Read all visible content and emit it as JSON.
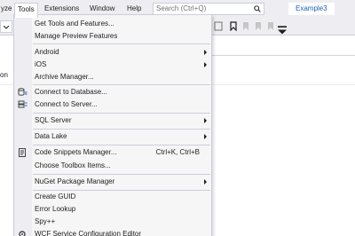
{
  "menubar": {
    "partial_left": "yze",
    "tools": "Tools",
    "extensions": "Extensions",
    "window": "Window",
    "help": "Help",
    "search_placeholder": "Search (Ctrl+Q)",
    "project": "Example3"
  },
  "editor": {
    "partial_text": "on"
  },
  "tools_menu": {
    "items": [
      {
        "label": "Get Tools and Features...",
        "icon": "",
        "shortcut": "",
        "submenu": false
      },
      {
        "label": "Manage Preview Features",
        "icon": "",
        "shortcut": "",
        "submenu": false
      },
      {
        "label": "Android",
        "icon": "",
        "shortcut": "",
        "submenu": true
      },
      {
        "label": "iOS",
        "icon": "",
        "shortcut": "",
        "submenu": true
      },
      {
        "label": "Archive Manager...",
        "icon": "",
        "shortcut": "",
        "submenu": false
      },
      {
        "label": "Connect to Database...",
        "icon": "database-connect-icon",
        "shortcut": "",
        "submenu": false
      },
      {
        "label": "Connect to Server...",
        "icon": "server-connect-icon",
        "shortcut": "",
        "submenu": false
      },
      {
        "label": "SQL Server",
        "icon": "",
        "shortcut": "",
        "submenu": true
      },
      {
        "label": "Data Lake",
        "icon": "",
        "shortcut": "",
        "submenu": true
      },
      {
        "label": "Code Snippets Manager...",
        "icon": "code-snippets-icon",
        "shortcut": "Ctrl+K, Ctrl+B",
        "submenu": false
      },
      {
        "label": "Choose Toolbox Items...",
        "icon": "",
        "shortcut": "",
        "submenu": false
      },
      {
        "label": "NuGet Package Manager",
        "icon": "",
        "shortcut": "",
        "submenu": true
      },
      {
        "label": "Create GUID",
        "icon": "",
        "shortcut": "",
        "submenu": false
      },
      {
        "label": "Error Lookup",
        "icon": "",
        "shortcut": "",
        "submenu": false
      },
      {
        "label": "Spy++",
        "icon": "",
        "shortcut": "",
        "submenu": false
      },
      {
        "label": "WCF Service Configuration Editor",
        "icon": "wcf-config-icon",
        "shortcut": "",
        "submenu": false
      }
    ]
  },
  "colors": {
    "chrome_bg": "#eeeef2",
    "menu_bg": "#f6f6f6",
    "border": "#cccedb",
    "accent": "#1e5fb8"
  }
}
